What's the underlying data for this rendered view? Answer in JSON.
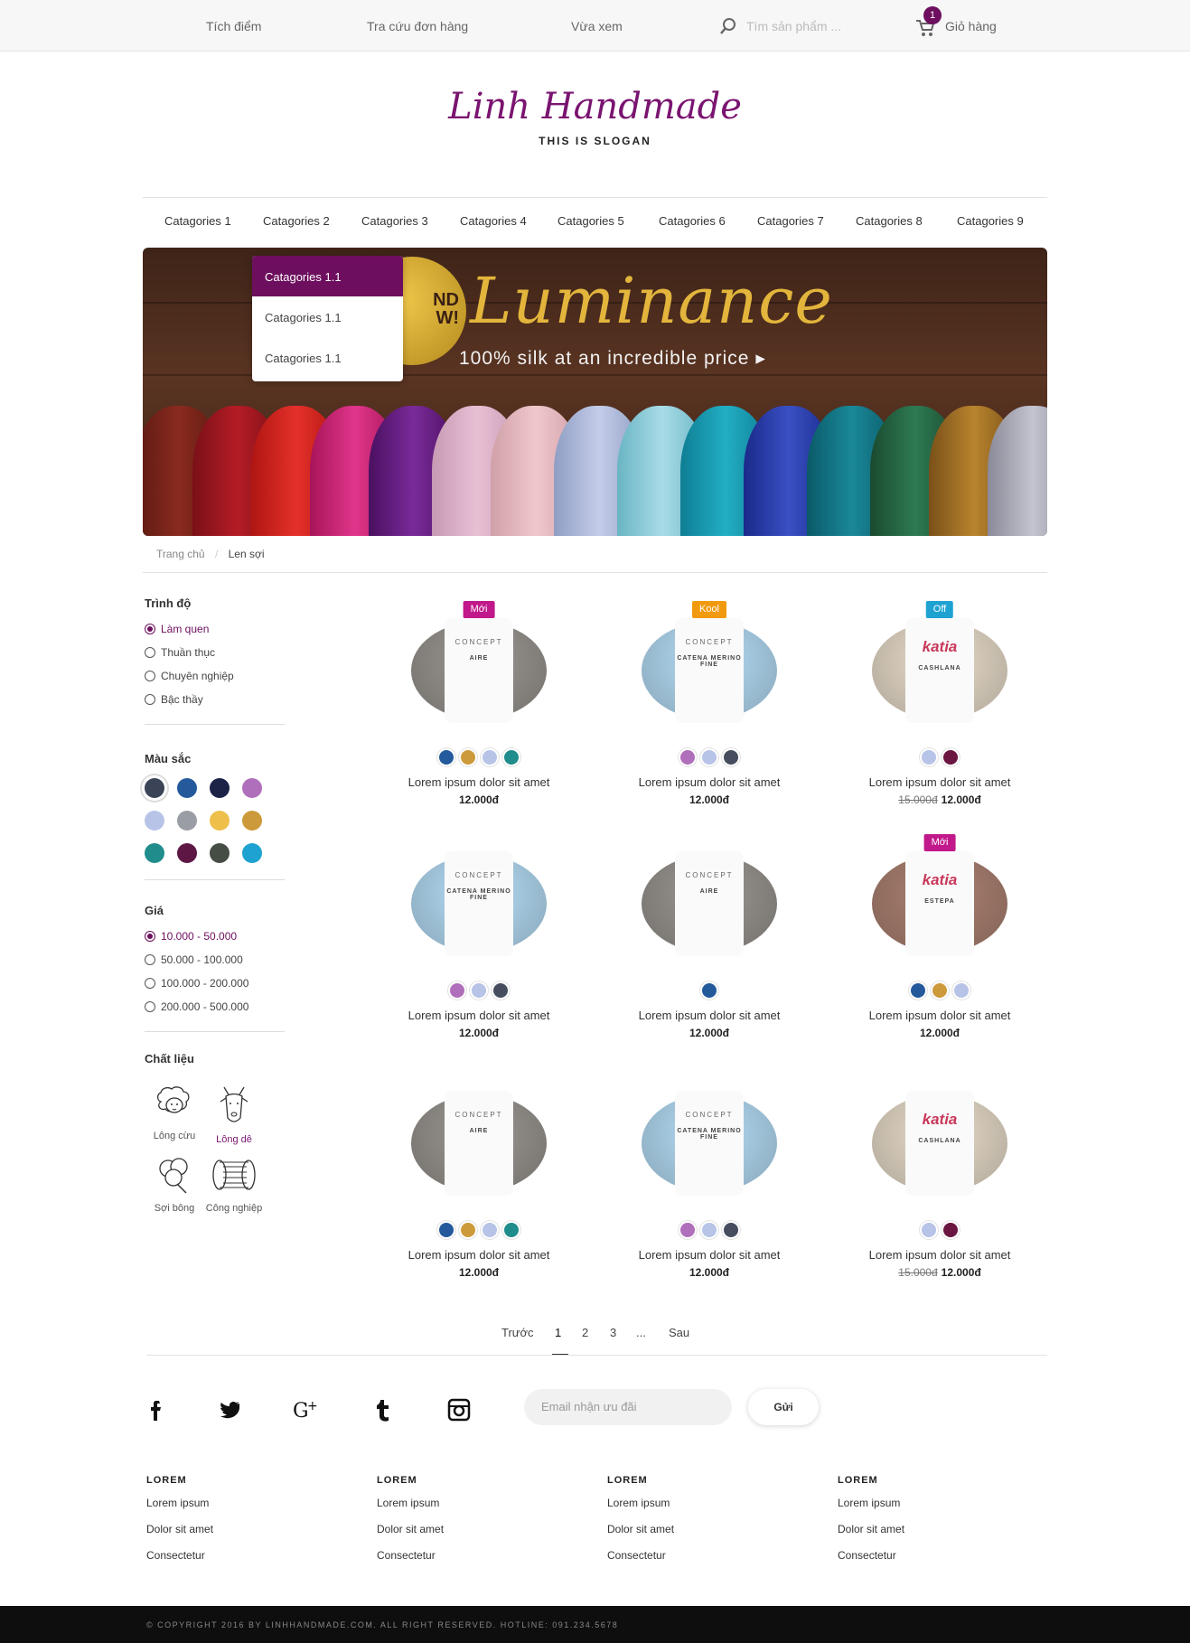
{
  "topbar": {
    "points": "Tích điểm",
    "order_lookup": "Tra cứu đơn hàng",
    "recent": "Vừa xem",
    "search_placeholder": "Tìm sản phẩm ...",
    "cart_count": "1",
    "cart_label": "Giỏ hàng"
  },
  "logo": {
    "name": "Linh Handmade",
    "slogan": "THIS IS SLOGAN"
  },
  "nav": {
    "categories": [
      "Catagories 1",
      "Catagories 2",
      "Catagories 3",
      "Catagories 4",
      "Catagories 5",
      "Catagories 6",
      "Catagories 7",
      "Catagories 8",
      "Catagories 9"
    ],
    "dropdown": [
      "Catagories 1.1",
      "Catagories 1.1",
      "Catagories 1.1"
    ]
  },
  "banner": {
    "title": "Luminance",
    "subtitle": "100% silk at an incredible price",
    "seal_text": "ND\nW!"
  },
  "breadcrumb": {
    "home": "Trang chủ",
    "separator": "/",
    "current": "Len sợi"
  },
  "filters": {
    "level": {
      "title": "Trình độ",
      "options": [
        "Làm quen",
        "Thuần thục",
        "Chuyên nghiệp",
        "Bậc thầy"
      ],
      "selected": 0
    },
    "color": {
      "title": "Màu sắc",
      "swatches": [
        "#3b4356",
        "#245a9c",
        "#1c2346",
        "#b06fbb",
        "#b7c4e8",
        "#9a9ea4",
        "#eec04b",
        "#cd9a3b",
        "#218c8c",
        "#5e1745",
        "#454d44",
        "#1ea2d1"
      ],
      "selected": 0
    },
    "price": {
      "title": "Giá",
      "options": [
        "10.000 - 50.000",
        "50.000 - 100.000",
        "100.000 - 200.000",
        "200.000 - 500.000"
      ],
      "selected": 0
    },
    "material": {
      "title": "Chất liệu",
      "options": [
        "Lông cừu",
        "Lông dê",
        "Sợi bông",
        "Công nghiệp"
      ],
      "selected": 1
    }
  },
  "products": [
    {
      "name": "Lorem ipsum dolor sit amet",
      "price": "12.000đ",
      "old_price": "",
      "tag": "Mới",
      "tag_color": "#c1198b",
      "yarn": "#8f8b86",
      "brand": "CONCEPT",
      "line": "AIRE",
      "dots": [
        "#245a9c",
        "#cd9a3b",
        "#b7c4e8",
        "#218c8c"
      ]
    },
    {
      "name": "Lorem ipsum dolor sit amet",
      "price": "12.000đ",
      "old_price": "",
      "tag": "Kool",
      "tag_color": "#f29a0f",
      "yarn": "#a8cde4",
      "brand": "CONCEPT",
      "line": "CATENA MERINO FINE",
      "dots": [
        "#b06fbb",
        "#b7c4e8",
        "#454d5e"
      ]
    },
    {
      "name": "Lorem ipsum dolor sit amet",
      "price": "12.000đ",
      "old_price": "15.000đ",
      "tag": "Off",
      "tag_color": "#1ea2d1",
      "yarn": "#d8cdbc",
      "brand": "katia",
      "line": "CASHLANA",
      "dots": [
        "#b7c4e8",
        "#6a1640"
      ]
    },
    {
      "name": "Lorem ipsum dolor sit amet",
      "price": "12.000đ",
      "old_price": "",
      "tag": "",
      "tag_color": "",
      "yarn": "#a8cde4",
      "brand": "CONCEPT",
      "line": "CATENA MERINO FINE",
      "dots": [
        "#b06fbb",
        "#b7c4e8",
        "#454d5e"
      ]
    },
    {
      "name": "Lorem ipsum dolor sit amet",
      "price": "12.000đ",
      "old_price": "",
      "tag": "",
      "tag_color": "",
      "yarn": "#8f8b86",
      "brand": "CONCEPT",
      "line": "AIRE",
      "dots": [
        "#245a9c"
      ]
    },
    {
      "name": "Lorem ipsum dolor sit amet",
      "price": "12.000đ",
      "old_price": "",
      "tag": "Mới",
      "tag_color": "#c1198b",
      "yarn": "#a0796a",
      "brand": "katia",
      "line": "ESTEPA",
      "dots": [
        "#245a9c",
        "#cd9a3b",
        "#b7c4e8"
      ]
    },
    {
      "name": "Lorem ipsum dolor sit amet",
      "price": "12.000đ",
      "old_price": "",
      "tag": "",
      "tag_color": "",
      "yarn": "#8f8b86",
      "brand": "CONCEPT",
      "line": "AIRE",
      "dots": [
        "#245a9c",
        "#cd9a3b",
        "#b7c4e8",
        "#218c8c"
      ]
    },
    {
      "name": "Lorem ipsum dolor sit amet",
      "price": "12.000đ",
      "old_price": "",
      "tag": "",
      "tag_color": "",
      "yarn": "#a8cde4",
      "brand": "CONCEPT",
      "line": "CATENA MERINO FINE",
      "dots": [
        "#b06fbb",
        "#b7c4e8",
        "#454d5e"
      ]
    },
    {
      "name": "Lorem ipsum dolor sit amet",
      "price": "12.000đ",
      "old_price": "15.000đ",
      "tag": "",
      "tag_color": "",
      "yarn": "#d8cdbc",
      "brand": "katia",
      "line": "CASHLANA",
      "dots": [
        "#b7c4e8",
        "#6a1640"
      ]
    }
  ],
  "pagination": {
    "prev": "Trước",
    "pages": [
      "1",
      "2",
      "3",
      "..."
    ],
    "current": "1",
    "next": "Sau"
  },
  "newsletter": {
    "placeholder": "Email nhận ưu đãi",
    "button": "Gửi"
  },
  "social": [
    "facebook-icon",
    "twitter-icon",
    "google-plus-icon",
    "tumblr-icon",
    "instagram-icon"
  ],
  "footer": {
    "columns": [
      {
        "title": "LOREM",
        "links": [
          "Lorem ipsum",
          "Dolor sit amet",
          "Consectetur"
        ]
      },
      {
        "title": "LOREM",
        "links": [
          "Lorem ipsum",
          "Dolor sit amet",
          "Consectetur"
        ]
      },
      {
        "title": "LOREM",
        "links": [
          "Lorem ipsum",
          "Dolor sit amet",
          "Consectetur"
        ]
      },
      {
        "title": "LOREM",
        "links": [
          "Lorem ipsum",
          "Dolor sit amet",
          "Consectetur"
        ]
      }
    ],
    "copyright": "© COPYRIGHT 2016 BY LINHHANDMADE.COM. ALL RIGHT RESERVED. HOTLINE: 091.234.5678"
  },
  "colors": {
    "brand": "#6d0f5e",
    "accent_gold": "#e3b53c"
  }
}
